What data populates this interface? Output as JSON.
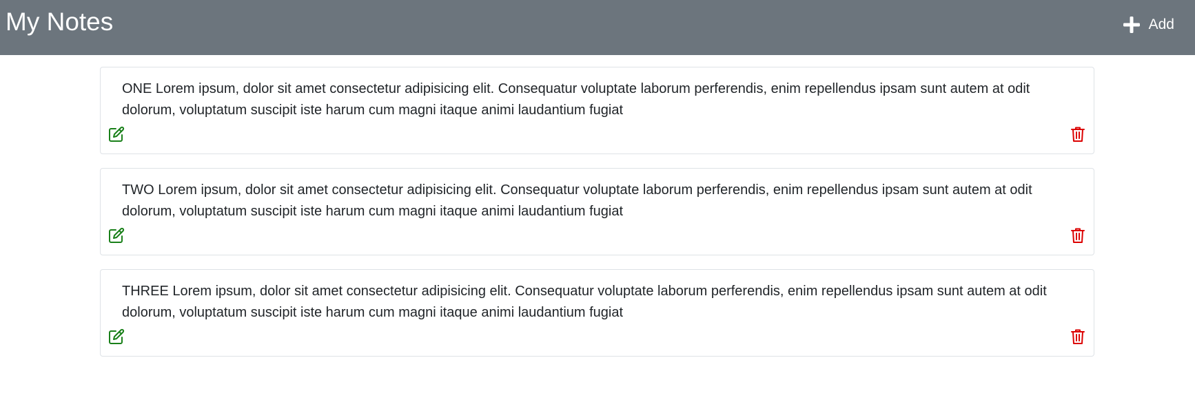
{
  "header": {
    "title": "My Notes",
    "add_label": "Add",
    "add_icon": "plus-icon",
    "background": "#6c757d"
  },
  "notes": [
    {
      "text": "ONE Lorem ipsum, dolor sit amet consectetur adipisicing elit. Consequatur voluptate laborum perferendis, enim repellendus ipsam sunt autem at odit dolorum, voluptatum suscipit iste harum cum magni itaque animi laudantium fugiat",
      "edit_icon": "edit-icon",
      "delete_icon": "trash-icon"
    },
    {
      "text": "TWO Lorem ipsum, dolor sit amet consectetur adipisicing elit. Consequatur voluptate laborum perferendis, enim repellendus ipsam sunt autem at odit dolorum, voluptatum suscipit iste harum cum magni itaque animi laudantium fugiat",
      "edit_icon": "edit-icon",
      "delete_icon": "trash-icon"
    },
    {
      "text": "THREE Lorem ipsum, dolor sit amet consectetur adipisicing elit. Consequatur voluptate laborum perferendis, enim repellendus ipsam sunt autem at odit dolorum, voluptatum suscipit iste harum cum magni itaque animi laudantium fugiat",
      "edit_icon": "edit-icon",
      "delete_icon": "trash-icon"
    }
  ],
  "colors": {
    "edit": "#198019",
    "delete": "#dc0000"
  }
}
